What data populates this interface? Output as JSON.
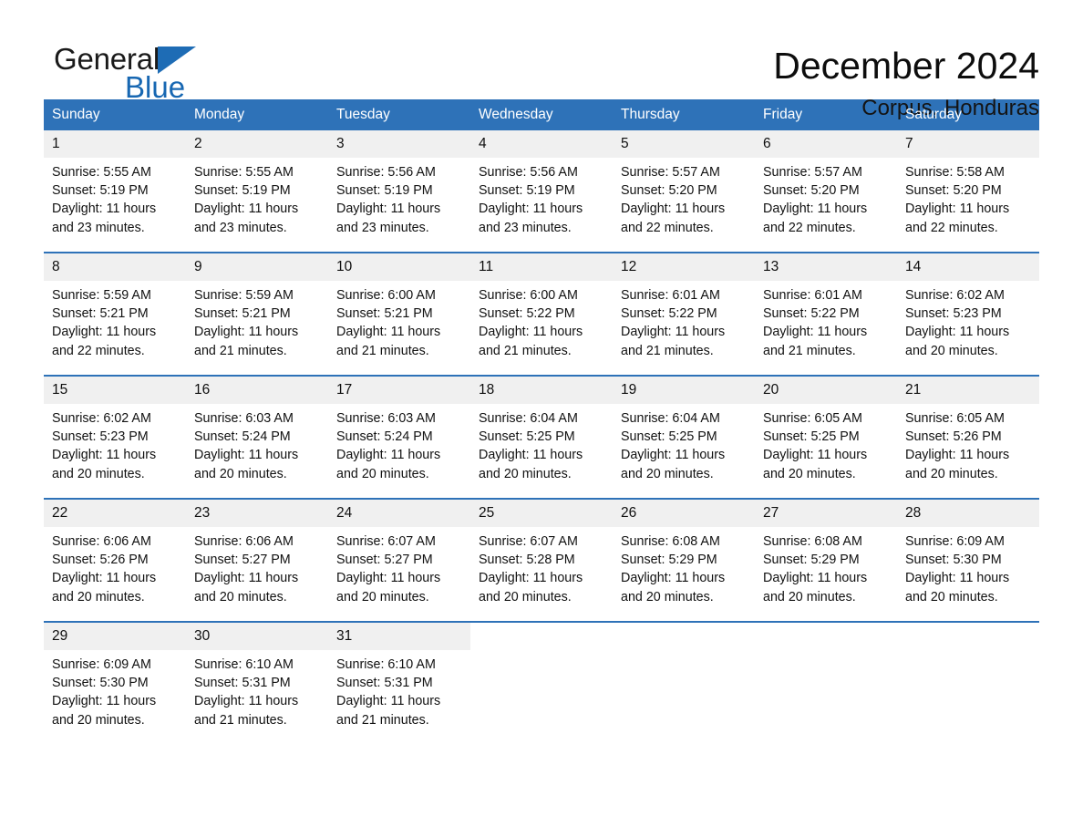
{
  "brand": {
    "name_part1": "General",
    "name_part2": "Blue",
    "flag_icon": "triangle-flag-icon",
    "accent_color": "#1767b2"
  },
  "header": {
    "title": "December 2024",
    "location": "Corpus, Honduras"
  },
  "theme": {
    "header_blue": "#2e72b8",
    "daynum_gray": "#f0f0f0",
    "text": "#111111"
  },
  "calendar": {
    "weekday_headers": [
      "Sunday",
      "Monday",
      "Tuesday",
      "Wednesday",
      "Thursday",
      "Friday",
      "Saturday"
    ],
    "labels": {
      "sunrise": "Sunrise:",
      "sunset": "Sunset:",
      "daylight": "Daylight:"
    },
    "weeks": [
      [
        {
          "day": "1",
          "sunrise": "Sunrise: 5:55 AM",
          "sunset": "Sunset: 5:19 PM",
          "daylight_line1": "Daylight: 11 hours",
          "daylight_line2": "and 23 minutes."
        },
        {
          "day": "2",
          "sunrise": "Sunrise: 5:55 AM",
          "sunset": "Sunset: 5:19 PM",
          "daylight_line1": "Daylight: 11 hours",
          "daylight_line2": "and 23 minutes."
        },
        {
          "day": "3",
          "sunrise": "Sunrise: 5:56 AM",
          "sunset": "Sunset: 5:19 PM",
          "daylight_line1": "Daylight: 11 hours",
          "daylight_line2": "and 23 minutes."
        },
        {
          "day": "4",
          "sunrise": "Sunrise: 5:56 AM",
          "sunset": "Sunset: 5:19 PM",
          "daylight_line1": "Daylight: 11 hours",
          "daylight_line2": "and 23 minutes."
        },
        {
          "day": "5",
          "sunrise": "Sunrise: 5:57 AM",
          "sunset": "Sunset: 5:20 PM",
          "daylight_line1": "Daylight: 11 hours",
          "daylight_line2": "and 22 minutes."
        },
        {
          "day": "6",
          "sunrise": "Sunrise: 5:57 AM",
          "sunset": "Sunset: 5:20 PM",
          "daylight_line1": "Daylight: 11 hours",
          "daylight_line2": "and 22 minutes."
        },
        {
          "day": "7",
          "sunrise": "Sunrise: 5:58 AM",
          "sunset": "Sunset: 5:20 PM",
          "daylight_line1": "Daylight: 11 hours",
          "daylight_line2": "and 22 minutes."
        }
      ],
      [
        {
          "day": "8",
          "sunrise": "Sunrise: 5:59 AM",
          "sunset": "Sunset: 5:21 PM",
          "daylight_line1": "Daylight: 11 hours",
          "daylight_line2": "and 22 minutes."
        },
        {
          "day": "9",
          "sunrise": "Sunrise: 5:59 AM",
          "sunset": "Sunset: 5:21 PM",
          "daylight_line1": "Daylight: 11 hours",
          "daylight_line2": "and 21 minutes."
        },
        {
          "day": "10",
          "sunrise": "Sunrise: 6:00 AM",
          "sunset": "Sunset: 5:21 PM",
          "daylight_line1": "Daylight: 11 hours",
          "daylight_line2": "and 21 minutes."
        },
        {
          "day": "11",
          "sunrise": "Sunrise: 6:00 AM",
          "sunset": "Sunset: 5:22 PM",
          "daylight_line1": "Daylight: 11 hours",
          "daylight_line2": "and 21 minutes."
        },
        {
          "day": "12",
          "sunrise": "Sunrise: 6:01 AM",
          "sunset": "Sunset: 5:22 PM",
          "daylight_line1": "Daylight: 11 hours",
          "daylight_line2": "and 21 minutes."
        },
        {
          "day": "13",
          "sunrise": "Sunrise: 6:01 AM",
          "sunset": "Sunset: 5:22 PM",
          "daylight_line1": "Daylight: 11 hours",
          "daylight_line2": "and 21 minutes."
        },
        {
          "day": "14",
          "sunrise": "Sunrise: 6:02 AM",
          "sunset": "Sunset: 5:23 PM",
          "daylight_line1": "Daylight: 11 hours",
          "daylight_line2": "and 20 minutes."
        }
      ],
      [
        {
          "day": "15",
          "sunrise": "Sunrise: 6:02 AM",
          "sunset": "Sunset: 5:23 PM",
          "daylight_line1": "Daylight: 11 hours",
          "daylight_line2": "and 20 minutes."
        },
        {
          "day": "16",
          "sunrise": "Sunrise: 6:03 AM",
          "sunset": "Sunset: 5:24 PM",
          "daylight_line1": "Daylight: 11 hours",
          "daylight_line2": "and 20 minutes."
        },
        {
          "day": "17",
          "sunrise": "Sunrise: 6:03 AM",
          "sunset": "Sunset: 5:24 PM",
          "daylight_line1": "Daylight: 11 hours",
          "daylight_line2": "and 20 minutes."
        },
        {
          "day": "18",
          "sunrise": "Sunrise: 6:04 AM",
          "sunset": "Sunset: 5:25 PM",
          "daylight_line1": "Daylight: 11 hours",
          "daylight_line2": "and 20 minutes."
        },
        {
          "day": "19",
          "sunrise": "Sunrise: 6:04 AM",
          "sunset": "Sunset: 5:25 PM",
          "daylight_line1": "Daylight: 11 hours",
          "daylight_line2": "and 20 minutes."
        },
        {
          "day": "20",
          "sunrise": "Sunrise: 6:05 AM",
          "sunset": "Sunset: 5:25 PM",
          "daylight_line1": "Daylight: 11 hours",
          "daylight_line2": "and 20 minutes."
        },
        {
          "day": "21",
          "sunrise": "Sunrise: 6:05 AM",
          "sunset": "Sunset: 5:26 PM",
          "daylight_line1": "Daylight: 11 hours",
          "daylight_line2": "and 20 minutes."
        }
      ],
      [
        {
          "day": "22",
          "sunrise": "Sunrise: 6:06 AM",
          "sunset": "Sunset: 5:26 PM",
          "daylight_line1": "Daylight: 11 hours",
          "daylight_line2": "and 20 minutes."
        },
        {
          "day": "23",
          "sunrise": "Sunrise: 6:06 AM",
          "sunset": "Sunset: 5:27 PM",
          "daylight_line1": "Daylight: 11 hours",
          "daylight_line2": "and 20 minutes."
        },
        {
          "day": "24",
          "sunrise": "Sunrise: 6:07 AM",
          "sunset": "Sunset: 5:27 PM",
          "daylight_line1": "Daylight: 11 hours",
          "daylight_line2": "and 20 minutes."
        },
        {
          "day": "25",
          "sunrise": "Sunrise: 6:07 AM",
          "sunset": "Sunset: 5:28 PM",
          "daylight_line1": "Daylight: 11 hours",
          "daylight_line2": "and 20 minutes."
        },
        {
          "day": "26",
          "sunrise": "Sunrise: 6:08 AM",
          "sunset": "Sunset: 5:29 PM",
          "daylight_line1": "Daylight: 11 hours",
          "daylight_line2": "and 20 minutes."
        },
        {
          "day": "27",
          "sunrise": "Sunrise: 6:08 AM",
          "sunset": "Sunset: 5:29 PM",
          "daylight_line1": "Daylight: 11 hours",
          "daylight_line2": "and 20 minutes."
        },
        {
          "day": "28",
          "sunrise": "Sunrise: 6:09 AM",
          "sunset": "Sunset: 5:30 PM",
          "daylight_line1": "Daylight: 11 hours",
          "daylight_line2": "and 20 minutes."
        }
      ],
      [
        {
          "day": "29",
          "sunrise": "Sunrise: 6:09 AM",
          "sunset": "Sunset: 5:30 PM",
          "daylight_line1": "Daylight: 11 hours",
          "daylight_line2": "and 20 minutes."
        },
        {
          "day": "30",
          "sunrise": "Sunrise: 6:10 AM",
          "sunset": "Sunset: 5:31 PM",
          "daylight_line1": "Daylight: 11 hours",
          "daylight_line2": "and 21 minutes."
        },
        {
          "day": "31",
          "sunrise": "Sunrise: 6:10 AM",
          "sunset": "Sunset: 5:31 PM",
          "daylight_line1": "Daylight: 11 hours",
          "daylight_line2": "and 21 minutes."
        },
        {
          "day": "",
          "sunrise": "",
          "sunset": "",
          "daylight_line1": "",
          "daylight_line2": ""
        },
        {
          "day": "",
          "sunrise": "",
          "sunset": "",
          "daylight_line1": "",
          "daylight_line2": ""
        },
        {
          "day": "",
          "sunrise": "",
          "sunset": "",
          "daylight_line1": "",
          "daylight_line2": ""
        },
        {
          "day": "",
          "sunrise": "",
          "sunset": "",
          "daylight_line1": "",
          "daylight_line2": ""
        }
      ]
    ]
  }
}
